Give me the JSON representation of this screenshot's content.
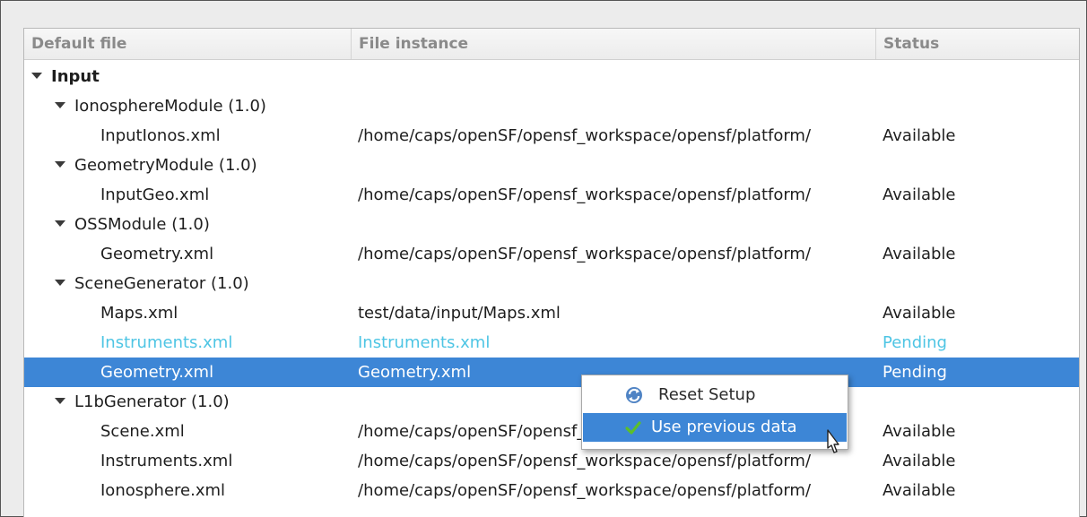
{
  "columns": [
    "Default file",
    "File instance",
    "Status"
  ],
  "rows": [
    {
      "name": "Input",
      "instance": "",
      "status": "",
      "level": 0,
      "expanded": true,
      "state": "normal"
    },
    {
      "name": "IonosphereModule (1.0)",
      "instance": "",
      "status": "",
      "level": 1,
      "expanded": true,
      "state": "normal"
    },
    {
      "name": "InputIonos.xml",
      "instance": "/home/caps/openSF/opensf_workspace/opensf/platform/",
      "status": "Available",
      "level": 2,
      "state": "normal"
    },
    {
      "name": "GeometryModule (1.0)",
      "instance": "",
      "status": "",
      "level": 1,
      "expanded": true,
      "state": "normal"
    },
    {
      "name": "InputGeo.xml",
      "instance": "/home/caps/openSF/opensf_workspace/opensf/platform/",
      "status": "Available",
      "level": 2,
      "state": "normal"
    },
    {
      "name": "OSSModule (1.0)",
      "instance": "",
      "status": "",
      "level": 1,
      "expanded": true,
      "state": "normal"
    },
    {
      "name": "Geometry.xml",
      "instance": "/home/caps/openSF/opensf_workspace/opensf/platform/",
      "status": "Available",
      "level": 2,
      "state": "normal"
    },
    {
      "name": "SceneGenerator (1.0)",
      "instance": "",
      "status": "",
      "level": 1,
      "expanded": true,
      "state": "normal"
    },
    {
      "name": "Maps.xml",
      "instance": "test/data/input/Maps.xml",
      "status": "Available",
      "level": 2,
      "state": "normal"
    },
    {
      "name": "Instruments.xml",
      "instance": "Instruments.xml",
      "status": "Pending",
      "level": 2,
      "state": "pending"
    },
    {
      "name": "Geometry.xml",
      "instance": "Geometry.xml",
      "status": "Pending",
      "level": 2,
      "state": "selected"
    },
    {
      "name": "L1bGenerator (1.0)",
      "instance": "",
      "status": "",
      "level": 1,
      "expanded": true,
      "state": "normal"
    },
    {
      "name": "Scene.xml",
      "instance": "/home/caps/openSF/opensf_workspace/opensf/platform/",
      "status": "Available",
      "level": 2,
      "state": "normal"
    },
    {
      "name": "Instruments.xml",
      "instance": "/home/caps/openSF/opensf_workspace/opensf/platform/",
      "status": "Available",
      "level": 2,
      "state": "normal"
    },
    {
      "name": "Ionosphere.xml",
      "instance": "/home/caps/openSF/opensf_workspace/opensf/platform/",
      "status": "Available",
      "level": 2,
      "state": "normal"
    }
  ],
  "context_menu": {
    "items": [
      {
        "label": "Reset Setup",
        "icon": "refresh-icon",
        "hover": false
      },
      {
        "label": "Use previous data",
        "icon": "checkmark-icon",
        "hover": true
      }
    ]
  },
  "colors": {
    "selection": "#3d86d6",
    "pending_text": "#4ec5e4",
    "check_green": "#5cbf2a",
    "refresh_blue": "#4f83c4"
  }
}
